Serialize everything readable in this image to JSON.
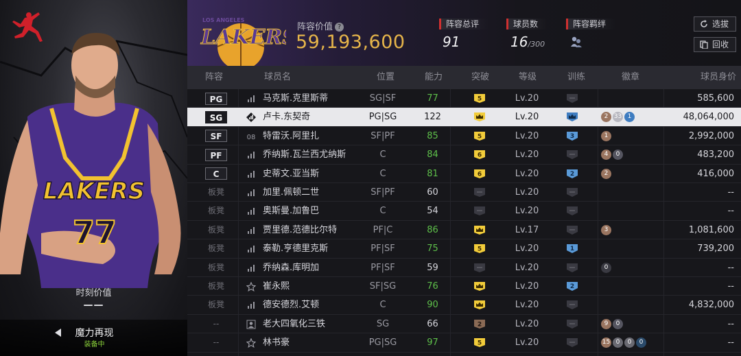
{
  "left": {
    "moment_label": "时刻价值",
    "moment_value": "——",
    "skill_name": "魔力再现",
    "skill_status": "装备中"
  },
  "header": {
    "team_logo_text": "LAKERS",
    "team_logo_sub": "LOS ANGELES",
    "value_label": "阵容价值",
    "value_num": "59,193,600",
    "rating_label": "阵容总评",
    "rating_val": "91",
    "players_label": "球员数",
    "players_val": "16",
    "players_max": "/300",
    "bond_label": "阵容羁绊",
    "btn_select": "选拔",
    "btn_recycle": "回收"
  },
  "columns": [
    "阵容",
    "球员名",
    "位置",
    "能力",
    "突破",
    "等级",
    "训练",
    "徽章",
    "球员身价"
  ],
  "rows": [
    {
      "slot": "PG",
      "starter": true,
      "name": "马克斯.克里斯蒂",
      "icon": "signal",
      "pos": "SG|SF",
      "ab": "77",
      "abc": "#5ec04a",
      "br": "5",
      "brt": "num",
      "lv": "Lv.20",
      "tr": "",
      "badges": [],
      "price": "585,600"
    },
    {
      "slot": "SG",
      "starter": true,
      "sel": true,
      "name": "卢卡.东契奇",
      "icon": "signal-diamond",
      "pos": "PG|SG",
      "ab": "122",
      "abc": "#1a1a1e",
      "br": "",
      "brt": "crown",
      "lv": "Lv.20",
      "tr": "crown",
      "badges": [
        {
          "t": "2",
          "c": "#9a7560"
        },
        {
          "t": "33",
          "c": "#b8b8c0"
        },
        {
          "t": "1",
          "c": "#3e7cc0"
        }
      ],
      "price": "48,064,000"
    },
    {
      "slot": "SF",
      "starter": true,
      "name": "特雷沃.阿里扎",
      "icon": "num08",
      "pos": "SF|PF",
      "ab": "85",
      "abc": "#5ec04a",
      "br": "5",
      "brt": "num",
      "lv": "Lv.20",
      "tr": "3",
      "badges": [
        {
          "t": "1",
          "c": "#9a7560"
        }
      ],
      "price": "2,992,000"
    },
    {
      "slot": "PF",
      "starter": true,
      "name": "乔纳斯.瓦兰西尤纳斯",
      "icon": "signal",
      "pos": "C",
      "ab": "84",
      "abc": "#5ec04a",
      "br": "6",
      "brt": "num",
      "lv": "Lv.20",
      "tr": "",
      "badges": [
        {
          "t": "4",
          "c": "#9a7560"
        },
        {
          "t": "0",
          "c": "#555560"
        }
      ],
      "price": "483,200"
    },
    {
      "slot": "C",
      "starter": true,
      "name": "史蒂文.亚当斯",
      "icon": "signal",
      "pos": "C",
      "ab": "81",
      "abc": "#5ec04a",
      "br": "6",
      "brt": "num",
      "lv": "Lv.20",
      "tr": "2",
      "badges": [
        {
          "t": "2",
          "c": "#9a7560"
        }
      ],
      "price": "416,000"
    },
    {
      "slot": "板凳",
      "starter": false,
      "name": "加里.佩顿二世",
      "icon": "signal",
      "pos": "SF|PF",
      "ab": "60",
      "abc": "#d6d6dc",
      "br": "",
      "brt": "none",
      "lv": "Lv.20",
      "tr": "",
      "badges": [],
      "price": "--"
    },
    {
      "slot": "板凳",
      "starter": false,
      "name": "奥斯曼.加鲁巴",
      "icon": "signal",
      "pos": "C",
      "ab": "54",
      "abc": "#d6d6dc",
      "br": "",
      "brt": "none",
      "lv": "Lv.20",
      "tr": "",
      "badges": [],
      "price": "--"
    },
    {
      "slot": "板凳",
      "starter": false,
      "name": "贾里德.范德比尔特",
      "icon": "signal",
      "pos": "PF|C",
      "ab": "86",
      "abc": "#5ec04a",
      "br": "",
      "brt": "crown",
      "lv": "Lv.17",
      "tr": "",
      "badges": [
        {
          "t": "3",
          "c": "#9a7560"
        }
      ],
      "price": "1,081,600"
    },
    {
      "slot": "板凳",
      "starter": false,
      "name": "泰勒.亨德里克斯",
      "icon": "signal",
      "pos": "PF|SF",
      "ab": "75",
      "abc": "#5ec04a",
      "br": "5",
      "brt": "num",
      "lv": "Lv.20",
      "tr": "1",
      "badges": [],
      "price": "739,200"
    },
    {
      "slot": "板凳",
      "starter": false,
      "name": "乔纳森.库明加",
      "icon": "signal",
      "pos": "PF|SF",
      "ab": "59",
      "abc": "#d6d6dc",
      "br": "",
      "brt": "none",
      "lv": "Lv.20",
      "tr": "",
      "badges": [
        {
          "t": "0",
          "c": "#3a3a42"
        }
      ],
      "price": "--"
    },
    {
      "slot": "板凳",
      "starter": false,
      "name": "崔永熙",
      "icon": "star",
      "pos": "SF|SG",
      "ab": "76",
      "abc": "#5ec04a",
      "br": "",
      "brt": "crown",
      "lv": "Lv.20",
      "tr": "2",
      "badges": [],
      "price": "--"
    },
    {
      "slot": "板凳",
      "starter": false,
      "name": "德安德烈.艾顿",
      "icon": "signal",
      "pos": "C",
      "ab": "90",
      "abc": "#5ec04a",
      "br": "",
      "brt": "crown",
      "lv": "Lv.20",
      "tr": "",
      "badges": [],
      "price": "4,832,000"
    },
    {
      "slot": "--",
      "starter": false,
      "name": "老大四氧化三铁",
      "icon": "person",
      "pos": "SG",
      "ab": "66",
      "abc": "#d6d6dc",
      "br": "2",
      "brt": "brown",
      "lv": "Lv.20",
      "tr": "",
      "badges": [
        {
          "t": "9",
          "c": "#9a7560"
        },
        {
          "t": "0",
          "c": "#555560"
        }
      ],
      "price": "--"
    },
    {
      "slot": "--",
      "starter": false,
      "name": "林书豪",
      "icon": "star",
      "pos": "PG|SG",
      "ab": "97",
      "abc": "#5ec04a",
      "br": "5",
      "brt": "num",
      "lv": "Lv.20",
      "tr": "",
      "badges": [
        {
          "t": "15",
          "c": "#9a7560"
        },
        {
          "t": "0",
          "c": "#6a6a72"
        },
        {
          "t": "0",
          "c": "#6a6a72"
        },
        {
          "t": "0",
          "c": "#2a4a6a"
        }
      ],
      "price": "--"
    }
  ],
  "colors": {
    "gold": "#e6b54a",
    "green": "#5ec04a",
    "red_accent": "#d03030",
    "purple": "#3a2a5c"
  }
}
